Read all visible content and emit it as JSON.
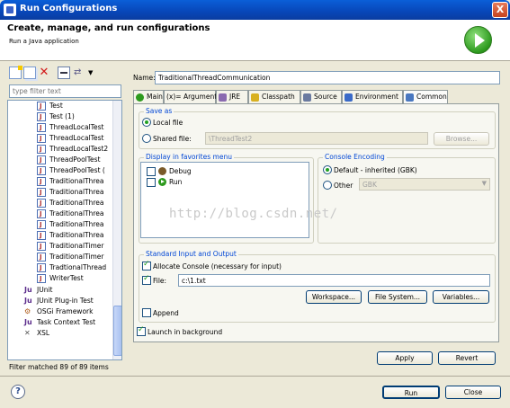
{
  "window": {
    "title": "Run Configurations",
    "close_glyph": "X"
  },
  "header": {
    "title": "Create, manage, and run configurations",
    "description": "Run a Java application",
    "icon": "run-icon"
  },
  "filter": {
    "placeholder": "type filter text",
    "status": "Filter matched 89 of 89 items"
  },
  "tree": {
    "items": [
      "Test",
      "Test (1)",
      "ThreadLocalTest",
      "ThreadLocalTest",
      "ThreadLocalTest2",
      "ThreadPoolTest",
      "ThreadPoolTest (",
      "TraditionalThrea",
      "TraditionalThrea",
      "TraditionalThrea",
      "TraditionalThrea",
      "TraditionalThrea",
      "TraditionalThrea",
      "TraditionalTimer",
      "TraditionalTimer",
      "TradtionalThread",
      "WriterTest"
    ],
    "groups": [
      "JUnit",
      "JUnit Plug-in Test",
      "OSGi Framework",
      "Task Context Test",
      "XSL"
    ]
  },
  "config": {
    "name_label": "Name:",
    "name_value": "TraditionalThreadCommunication",
    "tabs": [
      "Main",
      "(x)= Arguments",
      "JRE",
      "Classpath",
      "Source",
      "Environment",
      "Common"
    ],
    "active_tab": "Common"
  },
  "save_as": {
    "legend": "Save as",
    "local_label": "Local file",
    "shared_label": "Shared file:",
    "shared_value": "\\ThreadTest2",
    "browse": "Browse..."
  },
  "favorites": {
    "legend": "Display in favorites menu",
    "items": [
      "Debug",
      "Run"
    ]
  },
  "encoding": {
    "legend": "Console Encoding",
    "default_label": "Default - inherited (GBK)",
    "other_label": "Other",
    "other_value": "GBK"
  },
  "io": {
    "legend": "Standard Input and Output",
    "allocate_label": "Allocate Console (necessary for input)",
    "file_label": "File:",
    "file_value": "c:\\1.txt",
    "workspace": "Workspace...",
    "filesystem": "File System...",
    "variables": "Variables...",
    "append": "Append"
  },
  "launch_bg": "Launch in background",
  "buttons": {
    "apply": "Apply",
    "revert": "Revert",
    "run": "Run",
    "close": "Close"
  },
  "watermark": "http://blog.csdn.net/"
}
